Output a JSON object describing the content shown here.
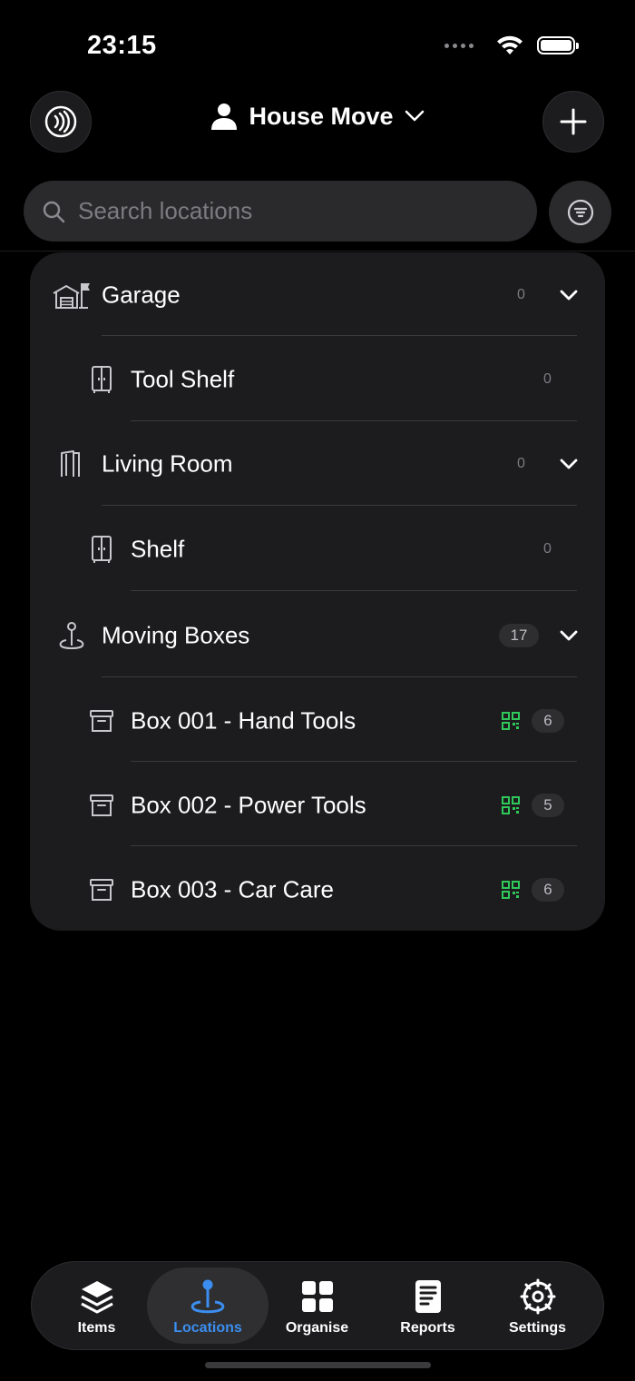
{
  "status": {
    "time": "23:15"
  },
  "header": {
    "title": "House Move"
  },
  "search": {
    "placeholder": "Search locations"
  },
  "locations": {
    "garage": {
      "label": "Garage",
      "count": "0"
    },
    "tool_shelf": {
      "label": "Tool Shelf",
      "count": "0"
    },
    "living_room": {
      "label": "Living Room",
      "count": "0"
    },
    "shelf": {
      "label": "Shelf",
      "count": "0"
    },
    "moving_boxes": {
      "label": "Moving Boxes",
      "count": "17"
    },
    "box1": {
      "label": "Box 001 - Hand Tools",
      "count": "6"
    },
    "box2": {
      "label": "Box 002 - Power Tools",
      "count": "5"
    },
    "box3": {
      "label": "Box 003 - Car Care",
      "count": "6"
    }
  },
  "tabs": {
    "items": "Items",
    "locations": "Locations",
    "organise": "Organise",
    "reports": "Reports",
    "settings": "Settings"
  },
  "colors": {
    "accent": "#3b8ef0",
    "qr": "#30c85a",
    "card": "#1c1c1e"
  }
}
